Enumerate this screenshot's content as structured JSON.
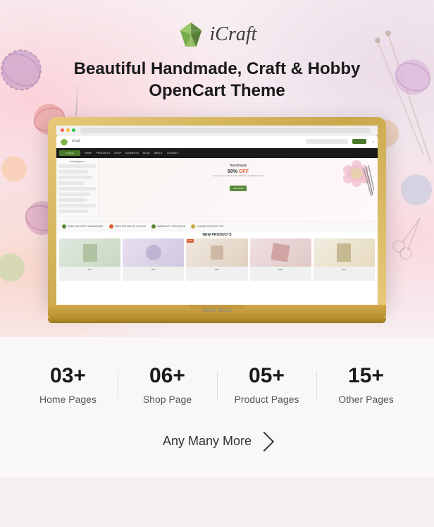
{
  "brand": {
    "name": "iCraft",
    "logo_alt": "iCraft logo"
  },
  "hero": {
    "title_line1": "Beautiful Handmade, Craft & Hobby",
    "title_line2": "OpenCart Theme"
  },
  "laptop": {
    "brand_label": "Applo Muzic"
  },
  "stats": [
    {
      "id": "home-pages",
      "number": "03+",
      "label": "Home Pages"
    },
    {
      "id": "shop-page",
      "number": "06+",
      "label": "Shop Page"
    },
    {
      "id": "product-pages",
      "number": "05+",
      "label": "Product Pages"
    },
    {
      "id": "other-pages",
      "number": "15+",
      "label": "Other Pages"
    }
  ],
  "more": {
    "label": "Any Many More",
    "arrow": "›"
  },
  "colors": {
    "green": "#5a8a3c",
    "orange": "#e05a2b",
    "gold": "#c9a84c",
    "pink_bg": "#f7eff2",
    "stats_bg": "#f9f7f7"
  }
}
